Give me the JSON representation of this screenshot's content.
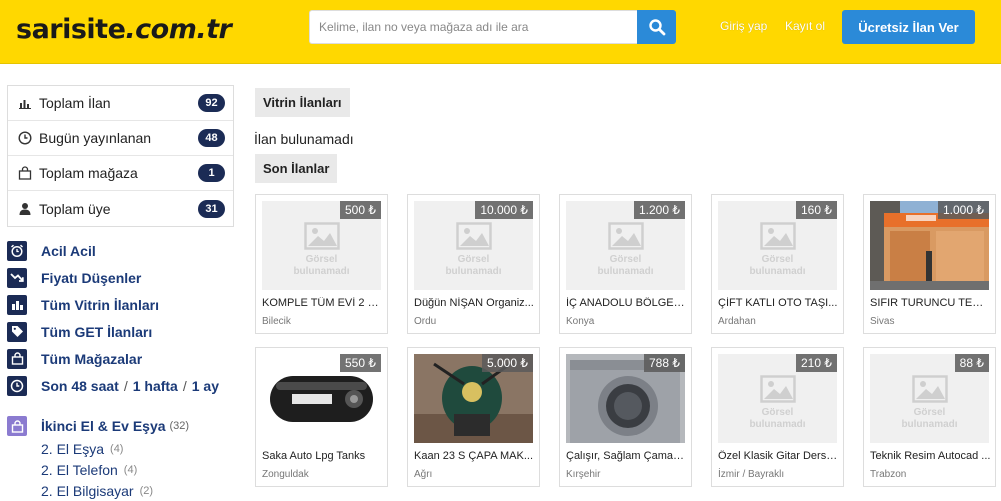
{
  "header": {
    "logo_main": "sarisite",
    "logo_domain": ".com.tr",
    "search_placeholder": "Kelime, ilan no veya mağaza adı ile ara",
    "login": "Giriş yap",
    "register": "Kayıt ol",
    "cta": "Ücretsiz İlan Ver"
  },
  "stats": [
    {
      "label": "Toplam İlan",
      "value": "92",
      "icon": "bar-chart-icon"
    },
    {
      "label": "Bugün yayınlanan",
      "value": "48",
      "icon": "clock-icon"
    },
    {
      "label": "Toplam mağaza",
      "value": "1",
      "icon": "shop-bag-icon"
    },
    {
      "label": "Toplam üye",
      "value": "31",
      "icon": "user-icon"
    }
  ],
  "nav": {
    "acil": "Acil Acil",
    "fiyat": "Fiyatı Düşenler",
    "vitrin": "Tüm Vitrin İlanları",
    "get": "Tüm GET İlanları",
    "magaza": "Tüm Mağazalar",
    "t48": "Son 48 saat",
    "t1h": "1 hafta",
    "t1a": "1 ay",
    "sep": "/"
  },
  "category": {
    "name": "İkinci El & Ev Eşya",
    "count": "(32)",
    "subs": [
      {
        "label": "2. El Eşya",
        "count": "(4)"
      },
      {
        "label": "2. El Telefon",
        "count": "(4)"
      },
      {
        "label": "2. El Bilgisayar",
        "count": "(2)"
      }
    ]
  },
  "main": {
    "vitrin_tab": "Vitrin İlanları",
    "empty": "İlan bulunamadı",
    "son_tab": "Son İlanlar",
    "placeholder_line1": "Görsel",
    "placeholder_line2": "bulunamadı"
  },
  "listings": [
    {
      "price": "500 ₺",
      "title": "KOMPLE TÜM EVİ 2 G...",
      "location": "Bilecik",
      "image": "placeholder"
    },
    {
      "price": "10.000 ₺",
      "title": "Düğün NİŞAN Organiz...",
      "location": "Ordu",
      "image": "placeholder"
    },
    {
      "price": "1.200 ₺",
      "title": "İÇ ANADOLU BÖLGES...",
      "location": "Konya",
      "image": "placeholder"
    },
    {
      "price": "160 ₺",
      "title": "ÇİFT KATLI OTO TAŞI...",
      "location": "Ardahan",
      "image": "placeholder"
    },
    {
      "price": "1.000 ₺",
      "title": "SIFIR TURUNCU TENTE",
      "location": "Sivas",
      "image": "awning-photo"
    },
    {
      "price": "550 ₺",
      "title": "Saka Auto Lpg Tanks",
      "location": "Zonguldak",
      "image": "lpg-tank-photo"
    },
    {
      "price": "5.000 ₺",
      "title": "Kaan 23 S ÇAPA MAK...",
      "location": "Ağrı",
      "image": "tiller-photo"
    },
    {
      "price": "788 ₺",
      "title": "Çalışır, Sağlam Çamaşı...",
      "location": "Kırşehir",
      "image": "washer-photo"
    },
    {
      "price": "210 ₺",
      "title": "Özel Klasik Gitar Dersi ...",
      "location": "İzmir / Bayraklı",
      "image": "placeholder"
    },
    {
      "price": "88 ₺",
      "title": "Teknik Resim Autocad ...",
      "location": "Trabzon",
      "image": "placeholder"
    }
  ]
}
